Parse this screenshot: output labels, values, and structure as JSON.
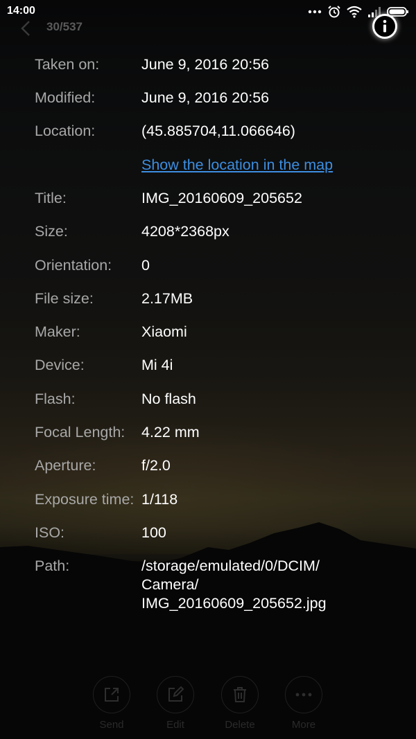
{
  "status_bar": {
    "time": "14:00",
    "icons": [
      "more-dots-icon",
      "alarm-icon",
      "wifi-icon",
      "signal-icon",
      "battery-icon"
    ]
  },
  "top_bar": {
    "counter": "30/537",
    "back_icon": "chevron-left-icon",
    "info_icon": "info-icon"
  },
  "details": [
    {
      "label": "Taken on:",
      "value": "June 9, 2016 20:56"
    },
    {
      "label": "Modified:",
      "value": "June 9, 2016 20:56"
    },
    {
      "label": "Location:",
      "value": "(45.885704,11.066646)"
    },
    {
      "label": "Title:",
      "value": "IMG_20160609_205652"
    },
    {
      "label": "Size:",
      "value": "4208*2368px"
    },
    {
      "label": "Orientation:",
      "value": "0"
    },
    {
      "label": "File size:",
      "value": "2.17MB"
    },
    {
      "label": "Maker:",
      "value": "Xiaomi"
    },
    {
      "label": "Device:",
      "value": "Mi 4i"
    },
    {
      "label": "Flash:",
      "value": "No flash"
    },
    {
      "label": "Focal Length:",
      "value": "4.22 mm"
    },
    {
      "label": "Aperture:",
      "value": "f/2.0"
    },
    {
      "label": "Exposure time:",
      "value": "1/118"
    },
    {
      "label": "ISO:",
      "value": "100"
    }
  ],
  "map_link": "Show the location in the map",
  "path": {
    "label": "Path:",
    "lines": [
      "/storage/emulated/0/DCIM/",
      "Camera/",
      "IMG_20160609_205652.jpg"
    ]
  },
  "toolbar": [
    {
      "label": "Send",
      "icon": "send-icon"
    },
    {
      "label": "Edit",
      "icon": "edit-icon"
    },
    {
      "label": "Delete",
      "icon": "trash-icon"
    },
    {
      "label": "More",
      "icon": "more-icon"
    }
  ],
  "colors": {
    "label": "#a8a8a8",
    "value": "#ffffff",
    "link": "#3d8ee0",
    "dim": "#2a2a2a"
  }
}
